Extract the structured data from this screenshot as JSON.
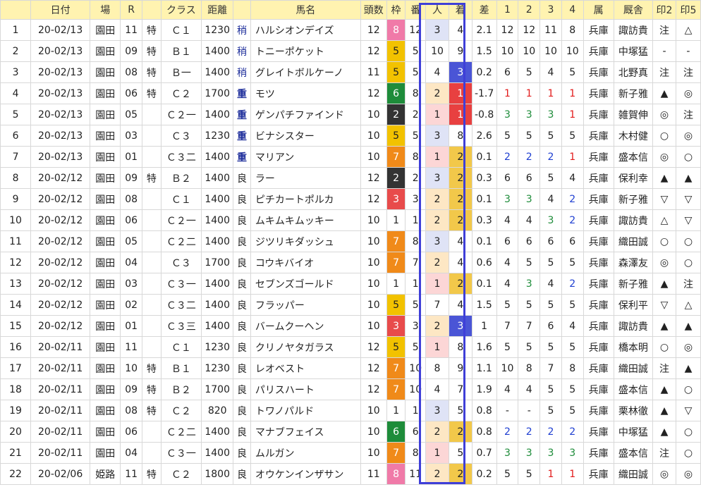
{
  "columns": [
    "",
    "日付",
    "場",
    "R",
    "",
    "クラス",
    "距離",
    "",
    "馬名",
    "頭数",
    "枠",
    "番",
    "人",
    "着",
    "差",
    "1",
    "2",
    "3",
    "4",
    "属",
    "厩舎",
    "印2",
    "印5"
  ],
  "rows": [
    {
      "no": "1",
      "date": "20-02/13",
      "venue": "園田",
      "race": "11",
      "special": "特",
      "cls": "Ｃ１",
      "dist": "1230",
      "cond": "稍",
      "horse": "ハルシオンデイズ",
      "heads": "12",
      "waku": "8",
      "uma": "12",
      "pop": "3",
      "fin": "4",
      "diff": "2.1",
      "p1": "12",
      "p2": "12",
      "p3": "11",
      "p4": "8",
      "affil": "兵庫",
      "stable": "諏訪貴",
      "m2": "注",
      "m5": "△"
    },
    {
      "no": "2",
      "date": "20-02/13",
      "venue": "園田",
      "race": "09",
      "special": "特",
      "cls": "Ｂ１",
      "dist": "1400",
      "cond": "稍",
      "horse": "トニーポケット",
      "heads": "12",
      "waku": "5",
      "uma": "5",
      "pop": "10",
      "fin": "9",
      "diff": "1.5",
      "p1": "10",
      "p2": "10",
      "p3": "10",
      "p4": "10",
      "affil": "兵庫",
      "stable": "中塚猛",
      "m2": "-",
      "m5": "-"
    },
    {
      "no": "3",
      "date": "20-02/13",
      "venue": "園田",
      "race": "08",
      "special": "特",
      "cls": "Ｂ一",
      "dist": "1400",
      "cond": "稍",
      "horse": "グレイトボルケーノ",
      "heads": "11",
      "waku": "5",
      "uma": "5",
      "pop": "4",
      "fin": "3",
      "diff": "0.2",
      "p1": "6",
      "p2": "5",
      "p3": "4",
      "p4": "5",
      "affil": "兵庫",
      "stable": "北野真",
      "m2": "注",
      "m5": "注"
    },
    {
      "no": "4",
      "date": "20-02/13",
      "venue": "園田",
      "race": "06",
      "special": "特",
      "cls": "Ｃ２",
      "dist": "1700",
      "cond": "重",
      "horse": "モツ",
      "heads": "12",
      "waku": "6",
      "uma": "8",
      "pop": "2",
      "fin": "1",
      "diff": "-1.7",
      "p1": "1",
      "p2": "1",
      "p3": "1",
      "p4": "1",
      "affil": "兵庫",
      "stable": "新子雅",
      "m2": "▲",
      "m5": "◎"
    },
    {
      "no": "5",
      "date": "20-02/13",
      "venue": "園田",
      "race": "05",
      "special": "",
      "cls": "Ｃ２一",
      "dist": "1400",
      "cond": "重",
      "horse": "ゲンパチファインド",
      "heads": "10",
      "waku": "2",
      "uma": "2",
      "pop": "1",
      "fin": "1",
      "diff": "-0.8",
      "p1": "3",
      "p2": "3",
      "p3": "3",
      "p4": "1",
      "affil": "兵庫",
      "stable": "雑賀伸",
      "m2": "◎",
      "m5": "注"
    },
    {
      "no": "6",
      "date": "20-02/13",
      "venue": "園田",
      "race": "03",
      "special": "",
      "cls": "Ｃ３",
      "dist": "1230",
      "cond": "重",
      "horse": "ビナシスター",
      "heads": "10",
      "waku": "5",
      "uma": "5",
      "pop": "3",
      "fin": "8",
      "diff": "2.6",
      "p1": "5",
      "p2": "5",
      "p3": "5",
      "p4": "5",
      "affil": "兵庫",
      "stable": "木村健",
      "m2": "○",
      "m5": "◎"
    },
    {
      "no": "7",
      "date": "20-02/13",
      "venue": "園田",
      "race": "01",
      "special": "",
      "cls": "Ｃ３二",
      "dist": "1400",
      "cond": "重",
      "horse": "マリアン",
      "heads": "10",
      "waku": "7",
      "uma": "8",
      "pop": "1",
      "fin": "2",
      "diff": "0.1",
      "p1": "2",
      "p2": "2",
      "p3": "2",
      "p4": "1",
      "affil": "兵庫",
      "stable": "盛本信",
      "m2": "◎",
      "m5": "○"
    },
    {
      "no": "8",
      "date": "20-02/12",
      "venue": "園田",
      "race": "09",
      "special": "特",
      "cls": "Ｂ２",
      "dist": "1400",
      "cond": "良",
      "horse": "ラー",
      "heads": "12",
      "waku": "2",
      "uma": "2",
      "pop": "3",
      "fin": "2",
      "diff": "0.3",
      "p1": "6",
      "p2": "6",
      "p3": "5",
      "p4": "4",
      "affil": "兵庫",
      "stable": "保利幸",
      "m2": "▲",
      "m5": "▲"
    },
    {
      "no": "9",
      "date": "20-02/12",
      "venue": "園田",
      "race": "08",
      "special": "",
      "cls": "Ｃ１",
      "dist": "1400",
      "cond": "良",
      "horse": "ピチカートポルカ",
      "heads": "12",
      "waku": "3",
      "uma": "3",
      "pop": "2",
      "fin": "2",
      "diff": "0.1",
      "p1": "3",
      "p2": "3",
      "p3": "4",
      "p4": "2",
      "affil": "兵庫",
      "stable": "新子雅",
      "m2": "▽",
      "m5": "▽"
    },
    {
      "no": "10",
      "date": "20-02/12",
      "venue": "園田",
      "race": "06",
      "special": "",
      "cls": "Ｃ２一",
      "dist": "1400",
      "cond": "良",
      "horse": "ムキムキムッキー",
      "heads": "10",
      "waku": "1",
      "uma": "1",
      "pop": "2",
      "fin": "2",
      "diff": "0.3",
      "p1": "4",
      "p2": "4",
      "p3": "3",
      "p4": "2",
      "affil": "兵庫",
      "stable": "諏訪貴",
      "m2": "△",
      "m5": "▽"
    },
    {
      "no": "11",
      "date": "20-02/12",
      "venue": "園田",
      "race": "05",
      "special": "",
      "cls": "Ｃ２二",
      "dist": "1400",
      "cond": "良",
      "horse": "ジツリキダッシュ",
      "heads": "10",
      "waku": "7",
      "uma": "8",
      "pop": "3",
      "fin": "4",
      "diff": "0.1",
      "p1": "6",
      "p2": "6",
      "p3": "6",
      "p4": "6",
      "affil": "兵庫",
      "stable": "織田誠",
      "m2": "○",
      "m5": "○"
    },
    {
      "no": "12",
      "date": "20-02/12",
      "venue": "園田",
      "race": "04",
      "special": "",
      "cls": "Ｃ３",
      "dist": "1700",
      "cond": "良",
      "horse": "コウキバイオ",
      "heads": "10",
      "waku": "7",
      "uma": "7",
      "pop": "2",
      "fin": "4",
      "diff": "0.6",
      "p1": "4",
      "p2": "5",
      "p3": "5",
      "p4": "5",
      "affil": "兵庫",
      "stable": "森澤友",
      "m2": "◎",
      "m5": "○"
    },
    {
      "no": "13",
      "date": "20-02/12",
      "venue": "園田",
      "race": "03",
      "special": "",
      "cls": "Ｃ３一",
      "dist": "1400",
      "cond": "良",
      "horse": "セブンズゴールド",
      "heads": "10",
      "waku": "1",
      "uma": "1",
      "pop": "1",
      "fin": "2",
      "diff": "0.1",
      "p1": "4",
      "p2": "3",
      "p3": "4",
      "p4": "2",
      "affil": "兵庫",
      "stable": "新子雅",
      "m2": "▲",
      "m5": "注"
    },
    {
      "no": "14",
      "date": "20-02/12",
      "venue": "園田",
      "race": "02",
      "special": "",
      "cls": "Ｃ３二",
      "dist": "1400",
      "cond": "良",
      "horse": "フラッパー",
      "heads": "10",
      "waku": "5",
      "uma": "5",
      "pop": "7",
      "fin": "4",
      "diff": "1.5",
      "p1": "5",
      "p2": "5",
      "p3": "5",
      "p4": "5",
      "affil": "兵庫",
      "stable": "保利平",
      "m2": "▽",
      "m5": "△"
    },
    {
      "no": "15",
      "date": "20-02/12",
      "venue": "園田",
      "race": "01",
      "special": "",
      "cls": "Ｃ３三",
      "dist": "1400",
      "cond": "良",
      "horse": "バームクーヘン",
      "heads": "10",
      "waku": "3",
      "uma": "3",
      "pop": "2",
      "fin": "3",
      "diff": "1",
      "p1": "7",
      "p2": "7",
      "p3": "6",
      "p4": "4",
      "affil": "兵庫",
      "stable": "諏訪貴",
      "m2": "▲",
      "m5": "▲"
    },
    {
      "no": "16",
      "date": "20-02/11",
      "venue": "園田",
      "race": "11",
      "special": "",
      "cls": "Ｃ１",
      "dist": "1230",
      "cond": "良",
      "horse": "クリノヤタガラス",
      "heads": "12",
      "waku": "5",
      "uma": "5",
      "pop": "1",
      "fin": "8",
      "diff": "1.6",
      "p1": "5",
      "p2": "5",
      "p3": "5",
      "p4": "5",
      "affil": "兵庫",
      "stable": "橋本明",
      "m2": "○",
      "m5": "◎"
    },
    {
      "no": "17",
      "date": "20-02/11",
      "venue": "園田",
      "race": "10",
      "special": "特",
      "cls": "Ｂ１",
      "dist": "1230",
      "cond": "良",
      "horse": "レオベスト",
      "heads": "12",
      "waku": "7",
      "uma": "10",
      "pop": "8",
      "fin": "9",
      "diff": "1.1",
      "p1": "10",
      "p2": "8",
      "p3": "7",
      "p4": "8",
      "affil": "兵庫",
      "stable": "織田誠",
      "m2": "注",
      "m5": "▲"
    },
    {
      "no": "18",
      "date": "20-02/11",
      "venue": "園田",
      "race": "09",
      "special": "特",
      "cls": "Ｂ２",
      "dist": "1700",
      "cond": "良",
      "horse": "パリスハート",
      "heads": "12",
      "waku": "7",
      "uma": "10",
      "pop": "4",
      "fin": "7",
      "diff": "1.9",
      "p1": "4",
      "p2": "4",
      "p3": "5",
      "p4": "5",
      "affil": "兵庫",
      "stable": "盛本信",
      "m2": "▲",
      "m5": "○"
    },
    {
      "no": "19",
      "date": "20-02/11",
      "venue": "園田",
      "race": "08",
      "special": "特",
      "cls": "Ｃ２",
      "dist": "820",
      "cond": "良",
      "horse": "トワノパルド",
      "heads": "10",
      "waku": "1",
      "uma": "1",
      "pop": "3",
      "fin": "5",
      "diff": "0.8",
      "p1": "-",
      "p2": "-",
      "p3": "5",
      "p4": "5",
      "affil": "兵庫",
      "stable": "栗林徹",
      "m2": "▲",
      "m5": "▽"
    },
    {
      "no": "20",
      "date": "20-02/11",
      "venue": "園田",
      "race": "06",
      "special": "",
      "cls": "Ｃ２二",
      "dist": "1400",
      "cond": "良",
      "horse": "マナブフェイス",
      "heads": "10",
      "waku": "6",
      "uma": "6",
      "pop": "2",
      "fin": "2",
      "diff": "0.8",
      "p1": "2",
      "p2": "2",
      "p3": "2",
      "p4": "2",
      "affil": "兵庫",
      "stable": "中塚猛",
      "m2": "▲",
      "m5": "○"
    },
    {
      "no": "21",
      "date": "20-02/11",
      "venue": "園田",
      "race": "04",
      "special": "",
      "cls": "Ｃ３一",
      "dist": "1400",
      "cond": "良",
      "horse": "ムルガン",
      "heads": "10",
      "waku": "7",
      "uma": "8",
      "pop": "1",
      "fin": "5",
      "diff": "0.7",
      "p1": "3",
      "p2": "3",
      "p3": "3",
      "p4": "3",
      "affil": "兵庫",
      "stable": "盛本信",
      "m2": "注",
      "m5": "○"
    },
    {
      "no": "22",
      "date": "20-02/06",
      "venue": "姫路",
      "race": "11",
      "special": "特",
      "cls": "Ｃ２",
      "dist": "1800",
      "cond": "良",
      "horse": "オウケンインザサン",
      "heads": "11",
      "waku": "8",
      "uma": "11",
      "pop": "2",
      "fin": "2",
      "diff": "0.2",
      "p1": "5",
      "p2": "5",
      "p3": "1",
      "p4": "1",
      "affil": "兵庫",
      "stable": "織田誠",
      "m2": "◎",
      "m5": "◎"
    }
  ]
}
